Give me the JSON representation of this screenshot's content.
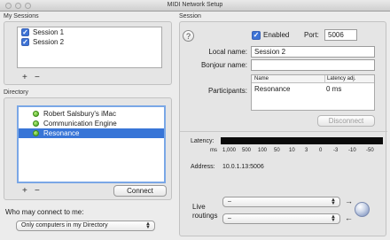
{
  "window": {
    "title": "MIDI Network Setup"
  },
  "my_sessions": {
    "label": "My Sessions",
    "items": [
      {
        "label": "Session 1",
        "checked": true
      },
      {
        "label": "Session 2",
        "checked": true
      }
    ],
    "add": "+",
    "remove": "−"
  },
  "directory": {
    "label": "Directory",
    "items": [
      {
        "label": "Robert Salsbury's iMac",
        "status": "green"
      },
      {
        "label": "Communication Engine",
        "status": "green"
      },
      {
        "label": "Resonance",
        "status": "green",
        "selected": true
      }
    ],
    "add": "+",
    "remove": "−",
    "connect": "Connect"
  },
  "who_may_connect": {
    "label": "Who may connect to me:",
    "selected": "Only computers in my Directory"
  },
  "session": {
    "label": "Session",
    "help": "?",
    "enabled_label": "Enabled",
    "enabled": true,
    "port_label": "Port:",
    "port": "5006",
    "local_name_label": "Local name:",
    "local_name": "Session 2",
    "bonjour_name_label": "Bonjour name:",
    "bonjour_name": "",
    "participants_label": "Participants:",
    "participants_columns": [
      "Name",
      "Latency adj."
    ],
    "participants": [
      {
        "name": "Resonance",
        "latency": "0 ms"
      }
    ],
    "disconnect": "Disconnect",
    "latency_label": "Latency:",
    "latency_scale": [
      "ms",
      "1,000",
      "500",
      "100",
      "50",
      "10",
      "3",
      "0",
      "-3",
      "-10",
      "-50"
    ],
    "address_label": "Address:",
    "address": "10.0.1.13:5006",
    "live_routings_label": "Live routings",
    "routing_in": "–",
    "routing_out": "–"
  },
  "colors": {
    "selection": "#3875d7",
    "status_green": "#3f9d19",
    "checkbox": "#3d73d6"
  }
}
